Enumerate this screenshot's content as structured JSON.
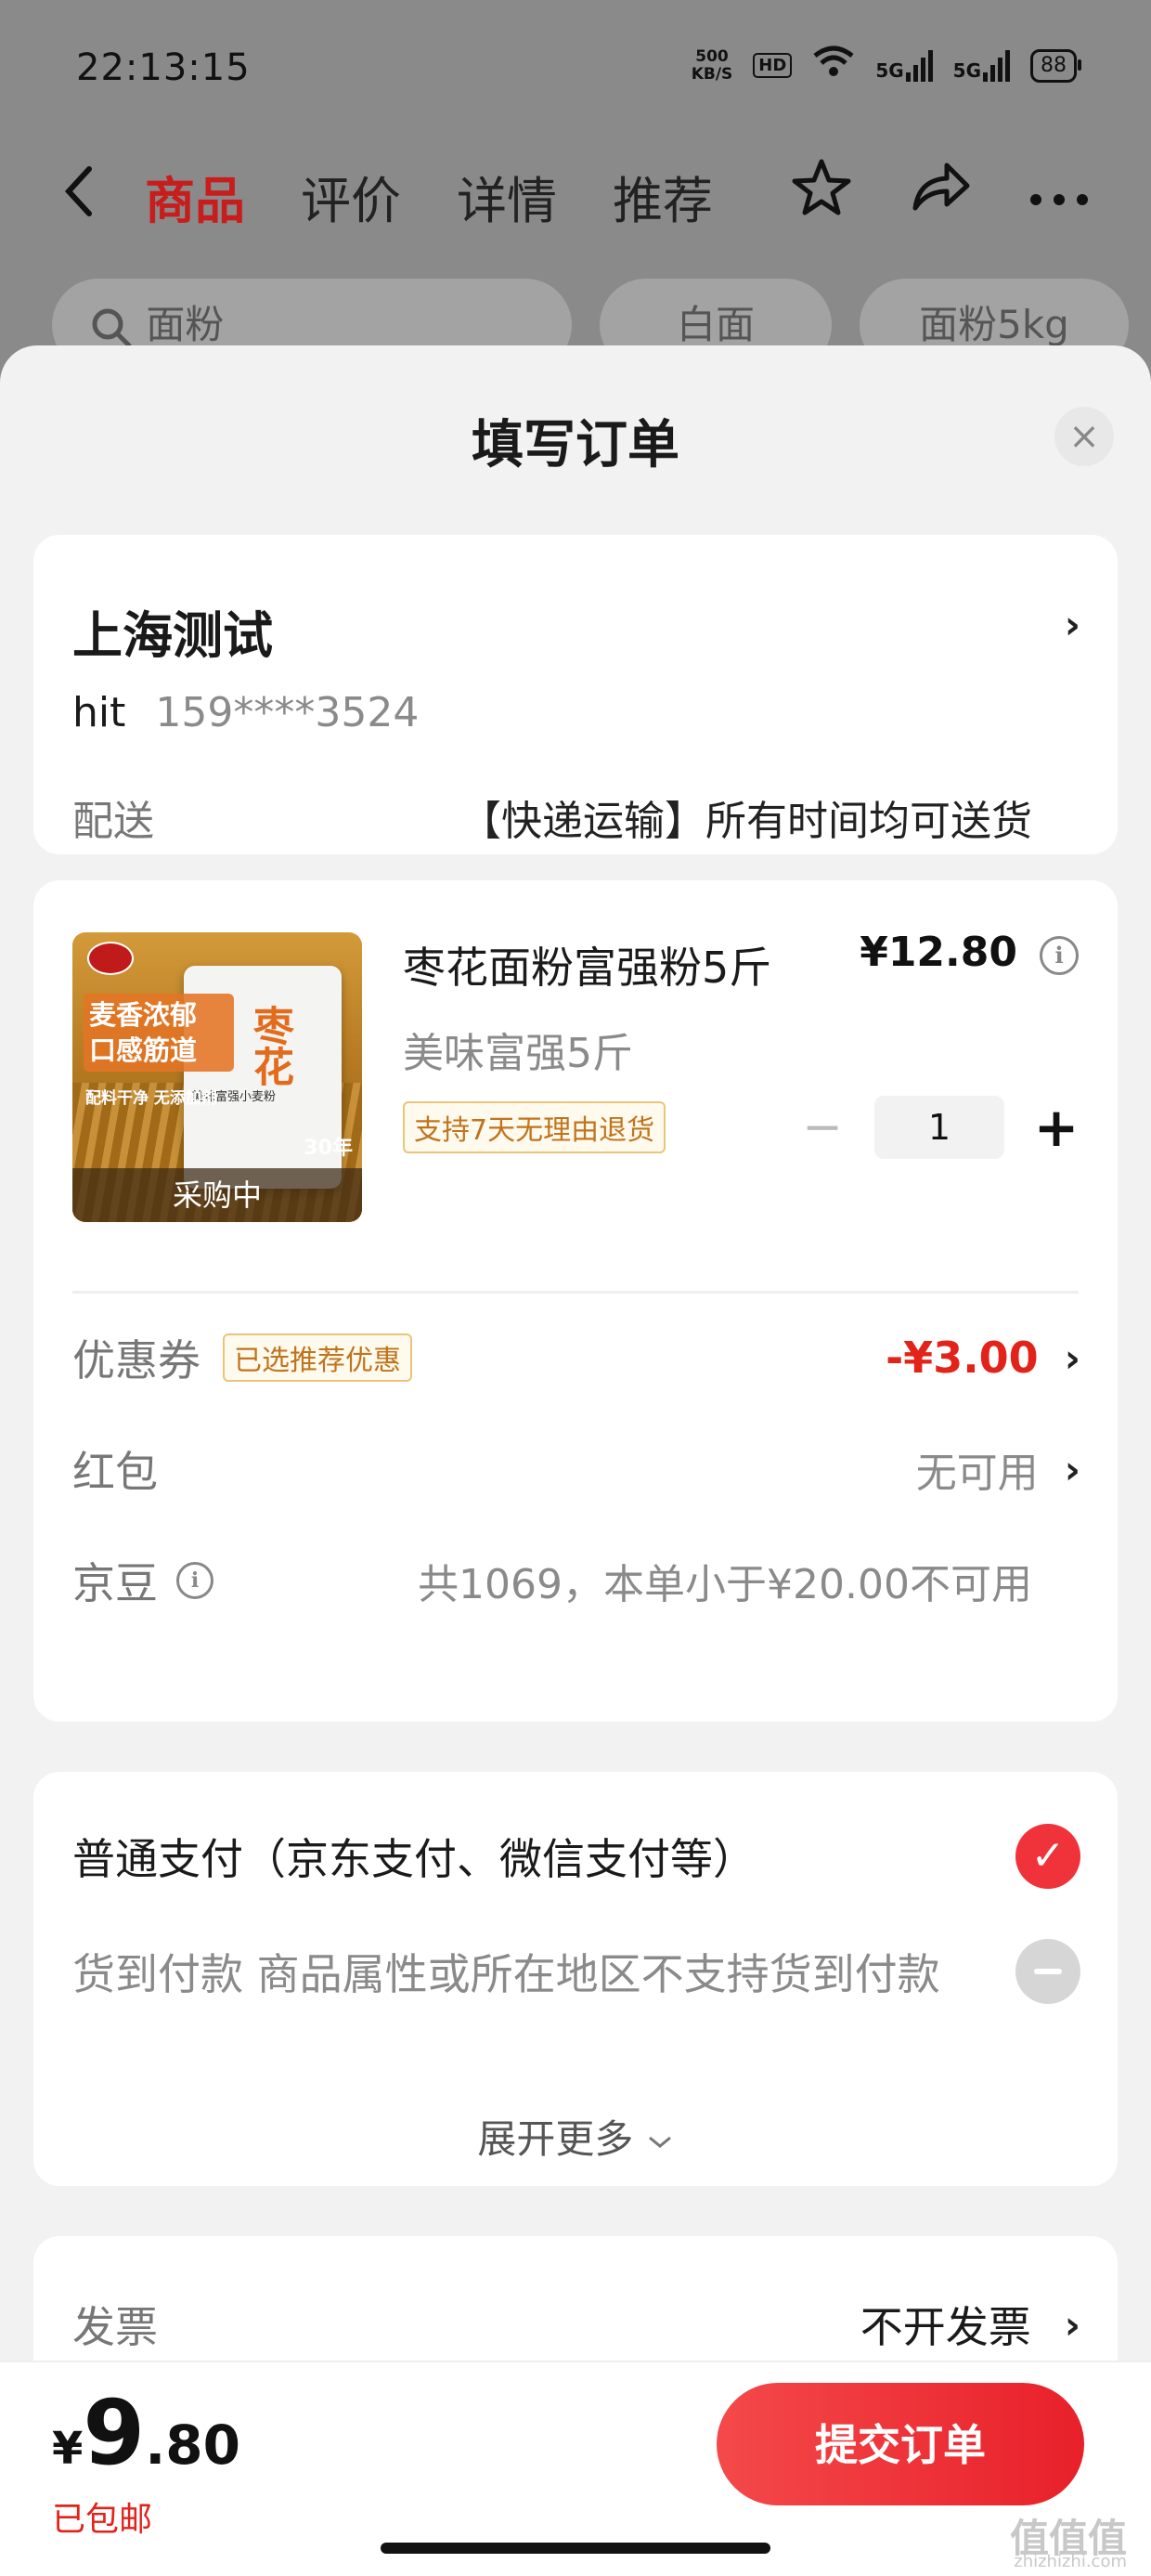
{
  "status_bar": {
    "time": "22:13:15",
    "net_speed_value": "500",
    "net_speed_unit": "KB/S",
    "hd_label": "HD",
    "sim1_label": "5G",
    "sim2_label": "5G",
    "battery": "88"
  },
  "nav": {
    "tabs": [
      {
        "label": "商品",
        "active": true
      },
      {
        "label": "评价",
        "active": false
      },
      {
        "label": "详情",
        "active": false
      },
      {
        "label": "推荐",
        "active": false
      }
    ]
  },
  "background_search": {
    "chips": [
      "面粉",
      "白面",
      "面粉5kg"
    ]
  },
  "sheet": {
    "title": "填写订单",
    "close_glyph": "×"
  },
  "address": {
    "name": "上海测试",
    "contact_name": "hit",
    "phone": "159****3524",
    "delivery_label": "配送",
    "delivery_value": "【快递运输】所有时间均可送货"
  },
  "product": {
    "image": {
      "brand_mark": "枣花",
      "bag_text": "美味富强小麦粉",
      "slogan": "麦香浓郁 口感筋道",
      "slogan_sub": "配料干净 无添加剂",
      "corner_text": "30年",
      "banner": "采购中"
    },
    "title": "枣花面粉富强粉5斤",
    "price": "¥12.80",
    "spec": "美味富强5斤",
    "return_tag": "支持7天无理由退货",
    "quantity": "1"
  },
  "discounts": {
    "coupon_label": "优惠券",
    "coupon_tag": "已选推荐优惠",
    "coupon_value": "-¥3.00",
    "redpacket_label": "红包",
    "redpacket_value": "无可用",
    "beans_label": "京豆",
    "beans_value": "共1069，本单小于¥20.00不可用"
  },
  "payment": {
    "normal_label": "普通支付（京东支付、微信支付等）",
    "cod_label": "货到付款 商品属性或所在地区不支持货到付款",
    "expand_label": "展开更多"
  },
  "invoice": {
    "label": "发票",
    "value": "不开发票"
  },
  "bottom_bar": {
    "currency": "¥",
    "total_int": "9",
    "total_dec": ".80",
    "shipping_note": "已包邮",
    "submit_label": "提交订单"
  },
  "watermark": {
    "text": "值值值",
    "sub": "zhizhizhi.com"
  },
  "colors": {
    "accent_red": "#e2231a",
    "tab_active": "#c81d1d",
    "submit_gradient_start": "#f4494a",
    "submit_gradient_end": "#e8202a",
    "tag_border": "#e9c57b",
    "tag_text": "#c0741c"
  }
}
